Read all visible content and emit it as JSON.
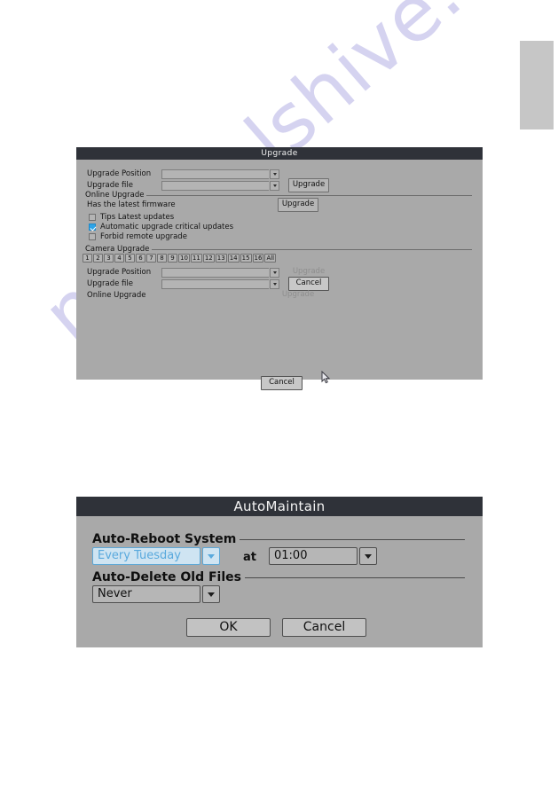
{
  "page": {
    "background_color": "#ffffff",
    "watermark_text": "manualshive.com",
    "watermark_color": "#7b76d0",
    "side_tab": {
      "name": "page-side-tab",
      "color": "#c6c6c6"
    }
  },
  "upgrade_dialog": {
    "title": "Upgrade",
    "title_bar_color": "#2f3239",
    "body_color": "#a9a9a9",
    "fields": [
      {
        "label": "Upgrade Position",
        "value": "",
        "placeholder": ""
      },
      {
        "label": "Upgrade file",
        "value": "",
        "placeholder": ""
      }
    ],
    "upgrade_file_button": "Upgrade",
    "online_upgrade_group": "Online Upgrade",
    "firmware_status": "Has the latest firmware",
    "firmware_upgrade_button": "Upgrade",
    "checkboxes": [
      {
        "label": "Tips Latest updates",
        "checked": false
      },
      {
        "label": "Automatic upgrade critical updates",
        "checked": true
      },
      {
        "label": "Forbid remote upgrade",
        "checked": false
      }
    ],
    "checkbox_accent": "#2da4e8",
    "camera_upgrade_group": "Camera Upgrade",
    "channels": [
      "1",
      "2",
      "3",
      "4",
      "5",
      "6",
      "7",
      "8",
      "9",
      "10",
      "11",
      "12",
      "13",
      "14",
      "15",
      "16",
      "All"
    ],
    "camera_fields": [
      {
        "label": "Upgrade Position",
        "value": "",
        "placeholder": ""
      },
      {
        "label": "Upgrade file",
        "value": "",
        "placeholder": ""
      }
    ],
    "camera_online_upgrade_label": "Online Upgrade",
    "camera_buttons": [
      {
        "label": "Upgrade",
        "enabled": false
      },
      {
        "label": "Cancel",
        "enabled": true
      },
      {
        "label": "Upgrade",
        "enabled": false
      }
    ],
    "footer_cancel_button": "Cancel"
  },
  "automaintain_dialog": {
    "title": "AutoMaintain",
    "title_bar_color": "#2f3239",
    "body_color": "#a9a9a9",
    "auto_reboot_group": "Auto-Reboot System",
    "reboot_day": "Every Tuesday",
    "at_label": "at",
    "reboot_time": "01:00",
    "selected_highlight_color": "#59a9dd",
    "auto_delete_group": "Auto-Delete Old Files",
    "auto_delete_value": "Never",
    "ok_button": "OK",
    "cancel_button": "Cancel"
  }
}
